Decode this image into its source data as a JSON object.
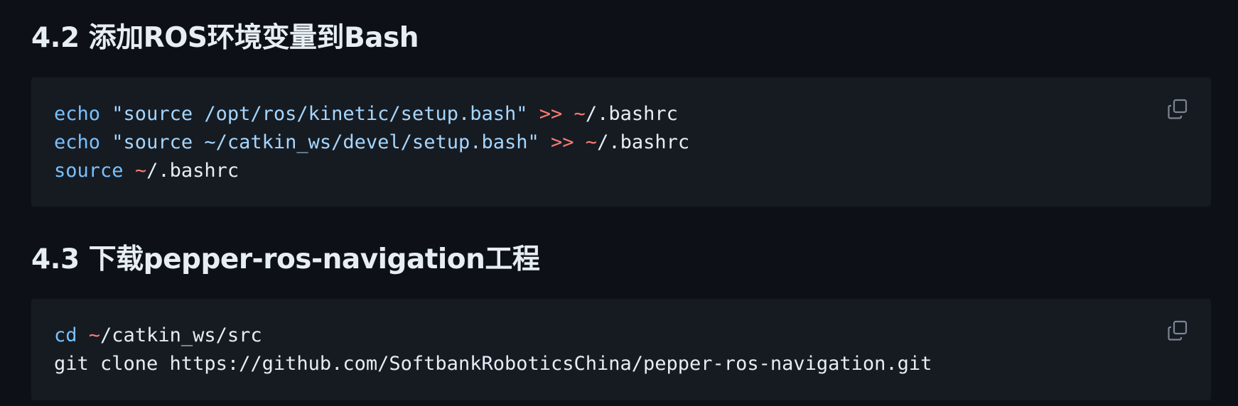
{
  "sections": [
    {
      "title": "4.2 添加ROS环境变量到Bash",
      "code_lines": [
        [
          {
            "text": "echo",
            "kind": "kw"
          },
          {
            "text": " ",
            "kind": "plain"
          },
          {
            "text": "\"source /opt/ros/kinetic/setup.bash\"",
            "kind": "str"
          },
          {
            "text": " ",
            "kind": "plain"
          },
          {
            "text": ">>",
            "kind": "op"
          },
          {
            "text": " ",
            "kind": "plain"
          },
          {
            "text": "~",
            "kind": "op"
          },
          {
            "text": "/.bashrc",
            "kind": "plain"
          }
        ],
        [
          {
            "text": "echo",
            "kind": "kw"
          },
          {
            "text": " ",
            "kind": "plain"
          },
          {
            "text": "\"source ~/catkin_ws/devel/setup.bash\"",
            "kind": "str"
          },
          {
            "text": " ",
            "kind": "plain"
          },
          {
            "text": ">>",
            "kind": "op"
          },
          {
            "text": " ",
            "kind": "plain"
          },
          {
            "text": "~",
            "kind": "op"
          },
          {
            "text": "/.bashrc",
            "kind": "plain"
          }
        ],
        [
          {
            "text": "source",
            "kind": "kw"
          },
          {
            "text": " ",
            "kind": "plain"
          },
          {
            "text": "~",
            "kind": "op"
          },
          {
            "text": "/.bashrc",
            "kind": "plain"
          }
        ]
      ]
    },
    {
      "title": "4.3 下载pepper-ros-navigation工程",
      "code_lines": [
        [
          {
            "text": "cd",
            "kind": "kw"
          },
          {
            "text": " ",
            "kind": "plain"
          },
          {
            "text": "~",
            "kind": "op"
          },
          {
            "text": "/catkin_ws/src",
            "kind": "plain"
          }
        ],
        [
          {
            "text": "git clone https://github.com/SoftbankRoboticsChina/pepper-ros-navigation.git",
            "kind": "plain"
          }
        ]
      ]
    }
  ],
  "icons": {
    "copy": "copy-icon"
  },
  "colors": {
    "page_background": "#0d1117",
    "code_background": "#161b22",
    "keyword": "#79c0ff",
    "string": "#a5d6ff",
    "operator": "#ff7b72",
    "text": "#e6edf3",
    "icon": "#7d8590"
  }
}
